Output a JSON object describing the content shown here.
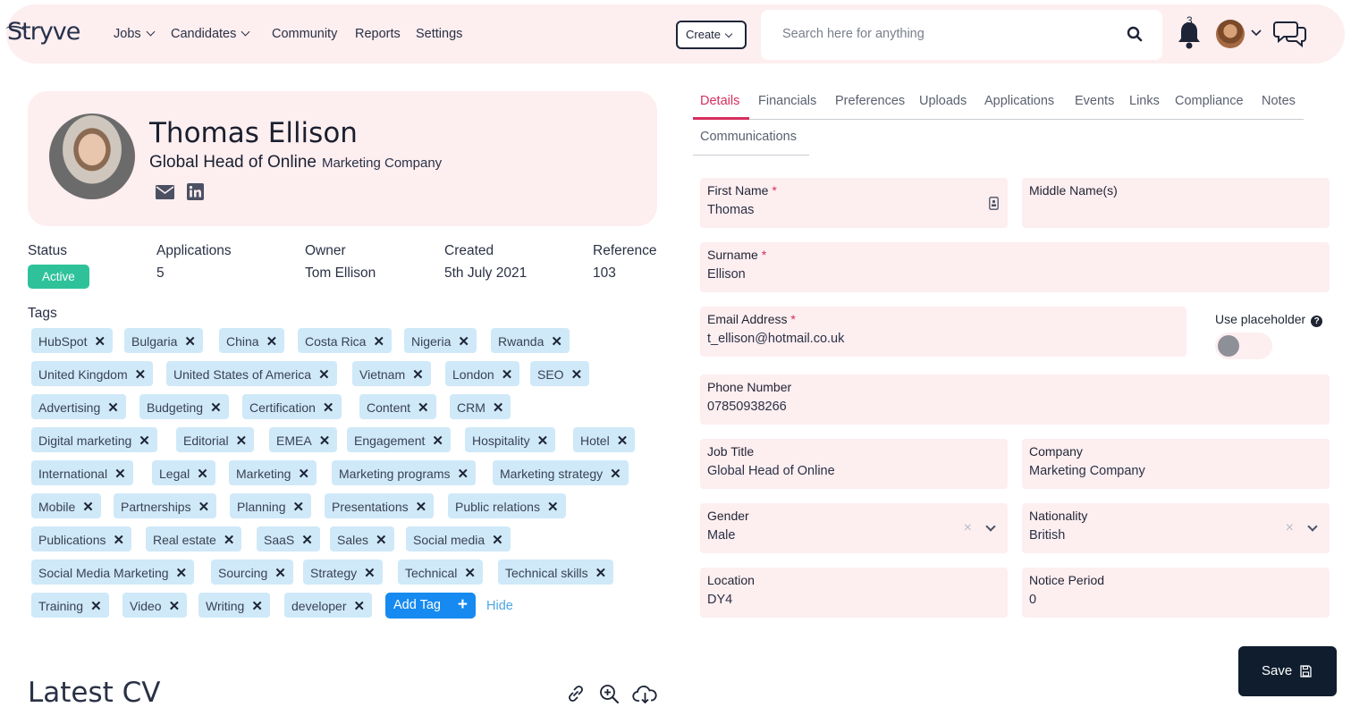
{
  "brand": {
    "logo": "Stryve"
  },
  "nav": {
    "jobs": "Jobs",
    "candidates": "Candidates",
    "community": "Community",
    "reports": "Reports",
    "settings": "Settings"
  },
  "header": {
    "create_label": "Create",
    "search_placeholder": "Search here for anything",
    "notification_count": "3"
  },
  "profile": {
    "name": "Thomas Ellison",
    "job_title": "Global Head of Online",
    "company": "Marketing Company"
  },
  "meta": {
    "status_label": "Status",
    "status_value": "Active",
    "applications_label": "Applications",
    "applications_value": "5",
    "owner_label": "Owner",
    "owner_value": "Tom Ellison",
    "created_label": "Created",
    "created_value": "5th July 2021",
    "reference_label": "Reference",
    "reference_value": "103"
  },
  "tags": {
    "heading": "Tags",
    "items": [
      "HubSpot",
      "Bulgaria",
      "China",
      "Costa Rica",
      "Nigeria",
      "Rwanda",
      "United Kingdom",
      "United States of America",
      "Vietnam",
      "London",
      "SEO",
      "Advertising",
      "Budgeting",
      "Certification",
      "Content",
      "CRM",
      "Digital marketing",
      "Editorial",
      "EMEA",
      "Engagement",
      "Hospitality",
      "Hotel",
      "International",
      "Legal",
      "Marketing",
      "Marketing programs",
      "Marketing strategy",
      "Mobile",
      "Partnerships",
      "Planning",
      "Presentations",
      "Public relations",
      "Publications",
      "Real estate",
      "SaaS",
      "Sales",
      "Social media",
      "Social Media Marketing",
      "Sourcing",
      "Strategy",
      "Technical",
      "Technical skills",
      "Training",
      "Video",
      "Writing",
      "developer"
    ],
    "add_label": "Add Tag",
    "hide_label": "Hide"
  },
  "cv": {
    "heading": "Latest CV"
  },
  "tabs": [
    "Details",
    "Financials",
    "Preferences",
    "Uploads",
    "Applications",
    "Events",
    "Links",
    "Compliance",
    "Notes",
    "Communications"
  ],
  "form": {
    "first_name": {
      "label": "First Name",
      "value": "Thomas"
    },
    "middle_name": {
      "label": "Middle Name(s)",
      "value": ""
    },
    "surname": {
      "label": "Surname",
      "value": "Ellison"
    },
    "email": {
      "label": "Email Address",
      "value": "t_ellison@hotmail.co.uk"
    },
    "use_placeholder": {
      "label": "Use placeholder",
      "on": false
    },
    "phone": {
      "label": "Phone Number",
      "value": "07850938266"
    },
    "job_title": {
      "label": "Job Title",
      "value": "Global Head of Online"
    },
    "company": {
      "label": "Company",
      "value": "Marketing Company"
    },
    "gender": {
      "label": "Gender",
      "value": "Male"
    },
    "nationality": {
      "label": "Nationality",
      "value": "British"
    },
    "location": {
      "label": "Location",
      "value": "DY4"
    },
    "notice_period": {
      "label": "Notice Period",
      "value": "0"
    },
    "required_mark": "*",
    "clear_glyph": "×"
  },
  "save": {
    "label": "Save"
  },
  "colors": {
    "accent": "#d62e5e",
    "tag_bg": "#cfe9f8",
    "status_active": "#2fc29a",
    "field_bg": "#fdeef0",
    "primary_button": "#168af0",
    "save_bg": "#0f1d2e"
  }
}
